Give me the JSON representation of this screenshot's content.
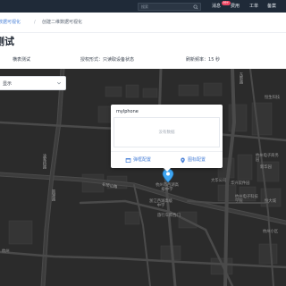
{
  "topbar": {
    "search_placeholder": "搜索",
    "nav": [
      {
        "label": "消息",
        "badge": "99+"
      },
      {
        "label": "费用"
      },
      {
        "label": "工单"
      },
      {
        "label": "备案"
      }
    ]
  },
  "breadcrumb": {
    "items": [
      "数据可视化",
      "创建二维数据可视化"
    ]
  },
  "page": {
    "title": "测试",
    "project": "横表测试",
    "auth_label": "授权形式：",
    "auth_value": "只读取设备状态",
    "refresh_label": "刷新频率：",
    "refresh_value": "15 秒"
  },
  "map": {
    "selector_value": "显示",
    "labels": {
      "road_east": "东新路",
      "road_west1": "凌家桥路",
      "road_west2": "南湖路",
      "road_south": "石桥山路",
      "poi_school": "杭州市西湖高级中学",
      "poi_hospital": "浙江西湖高级中学",
      "poi_bldg": "恒生科技",
      "poi_right1": "杭州电子商务园",
      "poi_right2": "新华园",
      "poi_right3": "华兴软件园",
      "poi_right4": "大华公司",
      "poi_right5": "恒大城",
      "poi_right6": "杭州电子科技学院",
      "poi_bottom": "杭州小区",
      "poi_mid": "旅行车库西门",
      "poi_left": "杭州"
    }
  },
  "popup": {
    "device_name": "mylphone",
    "empty_text": "没有数据",
    "btn_config": "弹框配置",
    "btn_icon": "图标配置"
  },
  "colors": {
    "accent": "#4b82d8",
    "marker": "#3fa6f2",
    "topbar": "#1f2a38",
    "map_bg": "#2a2a2a"
  }
}
